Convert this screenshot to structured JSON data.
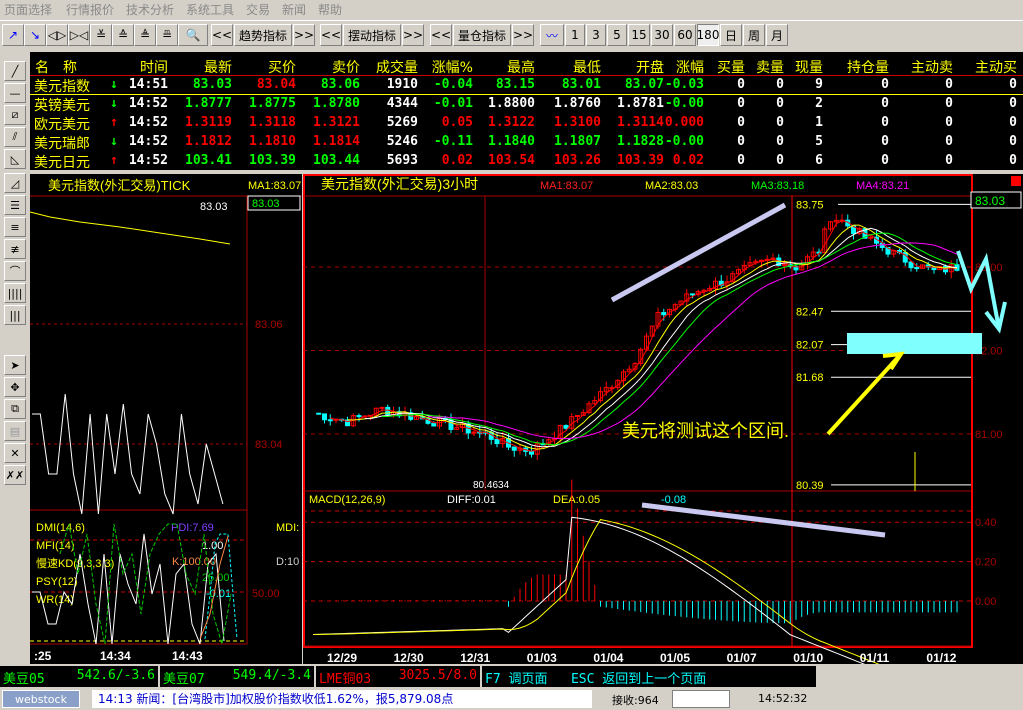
{
  "menu": [
    "页面选择",
    "行情报价",
    "技术分析",
    "系统工具",
    "交易",
    "新闻",
    "帮助"
  ],
  "toolbar": {
    "prev": "<<",
    "next": ">>",
    "trend_label": "趋势指标",
    "osc_label": "摆动指标",
    "vol_label": "量仓指标",
    "periods": [
      "1",
      "3",
      "5",
      "15",
      "30",
      "60",
      "180",
      "日",
      "周",
      "月"
    ],
    "active_period": "180"
  },
  "quote_table": {
    "headers": [
      "名　称",
      "",
      "时间",
      "最新",
      "买价",
      "卖价",
      "成交量",
      "涨幅%",
      "最高",
      "最低",
      "开盘",
      "涨幅",
      "买量",
      "卖量",
      "现量",
      "持仓量",
      "主动卖",
      "主动买"
    ],
    "rows": [
      {
        "name": "美元指数",
        "dir": "down",
        "cells": [
          [
            "14:51",
            "w"
          ],
          [
            "83.03",
            "g"
          ],
          [
            "83.04",
            "r"
          ],
          [
            "83.06",
            "g"
          ],
          [
            "1910",
            "w"
          ],
          [
            "-0.04",
            "g"
          ],
          [
            "83.15",
            "g"
          ],
          [
            "83.01",
            "g"
          ],
          [
            "83.07",
            "g"
          ],
          [
            "-0.03",
            "g"
          ],
          [
            "0",
            "w"
          ],
          [
            "0",
            "w"
          ],
          [
            "9",
            "w"
          ],
          [
            "0",
            "w"
          ],
          [
            "0",
            "w"
          ],
          [
            "0",
            "w"
          ]
        ]
      },
      {
        "name": "英镑美元",
        "dir": "down",
        "cells": [
          [
            "14:52",
            "w"
          ],
          [
            "1.8777",
            "g"
          ],
          [
            "1.8775",
            "g"
          ],
          [
            "1.8780",
            "g"
          ],
          [
            "4344",
            "w"
          ],
          [
            "-0.01",
            "g"
          ],
          [
            "1.8800",
            "w"
          ],
          [
            "1.8760",
            "w"
          ],
          [
            "1.8781",
            "w"
          ],
          [
            "-0.00",
            "g"
          ],
          [
            "0",
            "w"
          ],
          [
            "0",
            "w"
          ],
          [
            "2",
            "w"
          ],
          [
            "0",
            "w"
          ],
          [
            "0",
            "w"
          ],
          [
            "0",
            "w"
          ]
        ]
      },
      {
        "name": "欧元美元",
        "dir": "up",
        "cells": [
          [
            "14:52",
            "w"
          ],
          [
            "1.3119",
            "r"
          ],
          [
            "1.3118",
            "r"
          ],
          [
            "1.3121",
            "r"
          ],
          [
            "5269",
            "w"
          ],
          [
            "0.05",
            "r"
          ],
          [
            "1.3122",
            "r"
          ],
          [
            "1.3100",
            "r"
          ],
          [
            "1.3114",
            "r"
          ],
          [
            "0.000",
            "r"
          ],
          [
            "0",
            "w"
          ],
          [
            "0",
            "w"
          ],
          [
            "1",
            "w"
          ],
          [
            "0",
            "w"
          ],
          [
            "0",
            "w"
          ],
          [
            "0",
            "w"
          ]
        ]
      },
      {
        "name": "美元瑞郎",
        "dir": "down",
        "cells": [
          [
            "14:52",
            "w"
          ],
          [
            "1.1812",
            "r"
          ],
          [
            "1.1810",
            "r"
          ],
          [
            "1.1814",
            "r"
          ],
          [
            "5246",
            "w"
          ],
          [
            "-0.11",
            "g"
          ],
          [
            "1.1840",
            "g"
          ],
          [
            "1.1807",
            "g"
          ],
          [
            "1.1828",
            "g"
          ],
          [
            "-0.00",
            "g"
          ],
          [
            "0",
            "w"
          ],
          [
            "0",
            "w"
          ],
          [
            "5",
            "w"
          ],
          [
            "0",
            "w"
          ],
          [
            "0",
            "w"
          ],
          [
            "0",
            "w"
          ]
        ]
      },
      {
        "name": "美元日元",
        "dir": "up",
        "cells": [
          [
            "14:52",
            "w"
          ],
          [
            "103.41",
            "g"
          ],
          [
            "103.39",
            "g"
          ],
          [
            "103.44",
            "g"
          ],
          [
            "5693",
            "w"
          ],
          [
            "0.02",
            "r"
          ],
          [
            "103.54",
            "r"
          ],
          [
            "103.26",
            "r"
          ],
          [
            "103.39",
            "r"
          ],
          [
            "0.02",
            "r"
          ],
          [
            "0",
            "w"
          ],
          [
            "0",
            "w"
          ],
          [
            "6",
            "w"
          ],
          [
            "0",
            "w"
          ],
          [
            "0",
            "w"
          ],
          [
            "0",
            "w"
          ]
        ]
      }
    ]
  },
  "tick_chart": {
    "title": "美元指数(外汇交易)TICK",
    "ma1": "MA1:83.07",
    "current": "83.03",
    "price_box": "83.03",
    "levels": [
      "83.06",
      "83.04"
    ],
    "indicators": [
      "DMI(14,6)",
      "MFI(14)",
      "慢速KD(9,3,3,3)",
      "PSY(12)",
      "WR(14)"
    ],
    "pdi": "PDI:7.69",
    "mdi": "MDI:",
    "mfi_val": "1.00",
    "k_val": "K:100.00",
    "d_val": "D:10",
    "psy_val": "25.00",
    "wr_val": "-0.01",
    "level50": "50.00",
    "times": [
      ":25",
      "14:34",
      "14:43"
    ]
  },
  "main_chart": {
    "title": "美元指数(外汇交易)3小时",
    "ma": [
      "MA1:83.07",
      "MA2:83.03",
      "MA3:83.18",
      "MA4:83.21"
    ],
    "ma_colors": [
      "#ff2020",
      "#ffff00",
      "#00ff00",
      "#ff00ff"
    ],
    "price_box": "83.03",
    "high_label": "83.75",
    "low_label": "80.4634",
    "axis": [
      "83.00",
      "82.00",
      "81.00"
    ],
    "fib_levels": [
      {
        "p": 82.47,
        "t": "82.47"
      },
      {
        "p": 82.07,
        "t": "82.07"
      },
      {
        "p": 81.68,
        "t": "81.68"
      },
      {
        "p": 80.39,
        "t": "80.39"
      }
    ],
    "annotation": "美元将测试这个区间.",
    "price_path": [
      [
        0,
        81.25
      ],
      [
        6,
        81.15
      ],
      [
        12,
        81.3
      ],
      [
        18,
        81.2
      ],
      [
        24,
        81.1
      ],
      [
        30,
        81.0
      ],
      [
        34,
        80.85
      ],
      [
        38,
        80.8
      ],
      [
        44,
        81.1
      ],
      [
        48,
        81.35
      ],
      [
        52,
        81.6
      ],
      [
        56,
        81.9
      ],
      [
        60,
        82.4
      ],
      [
        64,
        82.6
      ],
      [
        68,
        82.75
      ],
      [
        72,
        82.85
      ],
      [
        76,
        83.0
      ],
      [
        80,
        83.1
      ],
      [
        84,
        83.0
      ],
      [
        88,
        83.2
      ],
      [
        90,
        83.6
      ],
      [
        92,
        83.55
      ],
      [
        96,
        83.35
      ],
      [
        100,
        83.2
      ],
      [
        104,
        83.05
      ],
      [
        108,
        82.95
      ],
      [
        112,
        83.0
      ]
    ],
    "macd": {
      "label": "MACD(12,26,9)",
      "diff": "DIFF:0.01",
      "dea": "DEA:0.05",
      "macd": "-0.08",
      "axis": [
        "0.40",
        "0.20",
        "0.00"
      ]
    },
    "dates": [
      "12/29",
      "12/30",
      "12/31",
      "01/03",
      "01/04",
      "01/05",
      "01/07",
      "01/10",
      "01/11",
      "01/12"
    ]
  },
  "ticker": [
    {
      "name": "美豆05",
      "val": "542.6/-3.6"
    },
    {
      "name": "美豆07",
      "val": "549.4/-3.4"
    },
    {
      "name": "LME铜03",
      "val": "3025.5/8.0"
    },
    {
      "f7": "F7 调页面",
      "esc": "ESC 返回到上一个页面"
    }
  ],
  "status": {
    "logo": "webstock",
    "news": "14:13 新闻：[台湾股市]加权股价指数收低1.62%，报5,879.08点",
    "recv": "接收:964",
    "clock": "14:52:32"
  }
}
